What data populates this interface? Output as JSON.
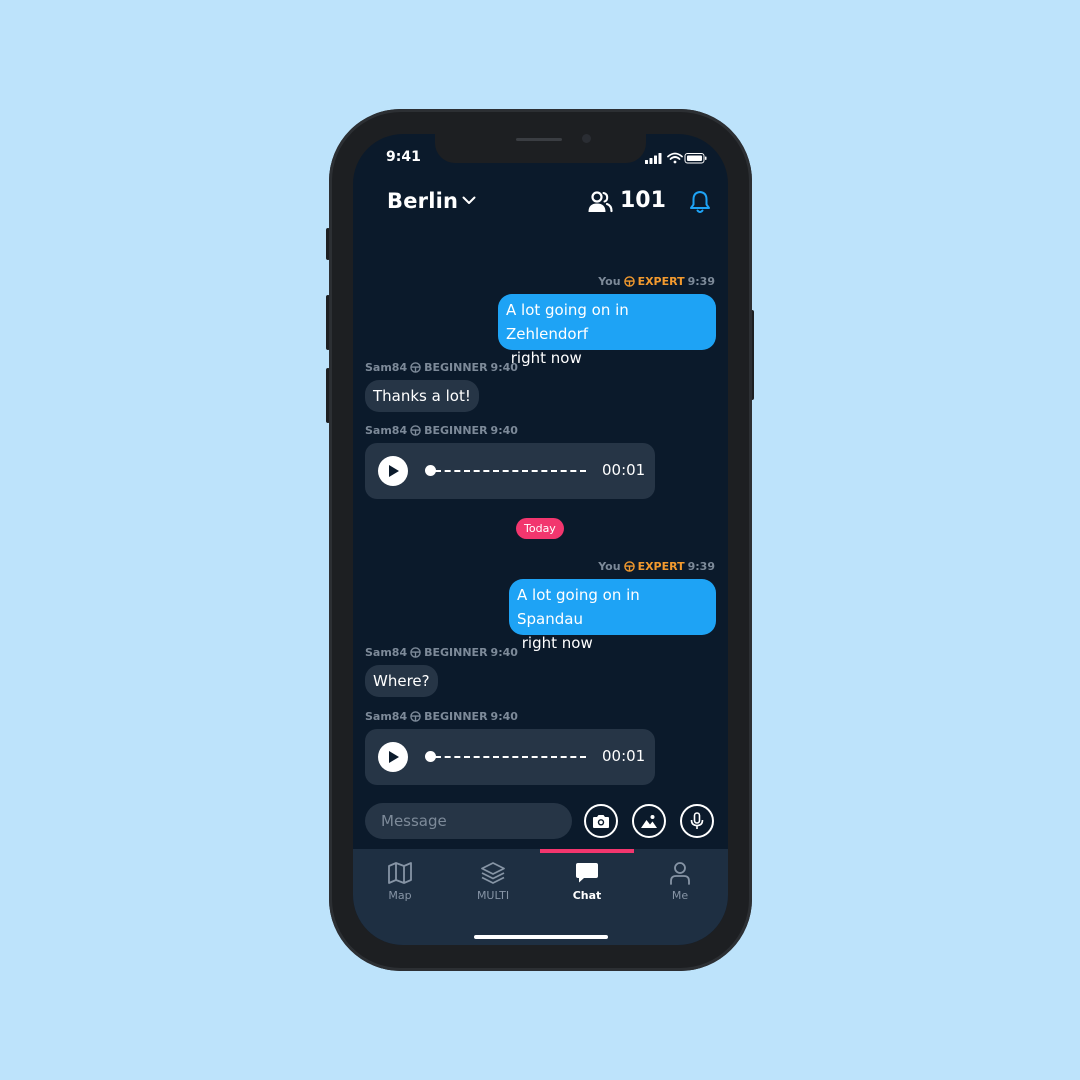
{
  "status": {
    "time": "9:41"
  },
  "header": {
    "city": "Berlin",
    "user_count": "101"
  },
  "messages": [
    {
      "sender": "You",
      "level": "EXPERT",
      "time": "9:39",
      "text_line1": "A lot going on in Zehlendorf",
      "text_line2": " right now"
    },
    {
      "sender": "Sam84",
      "level": "BEGINNER",
      "time": "9:40",
      "text": "Thanks a lot!"
    },
    {
      "sender": "Sam84",
      "level": "BEGINNER",
      "time": "9:40",
      "voice_duration": "00:01"
    },
    {
      "sender": "You",
      "level": "EXPERT",
      "time": "9:39",
      "text_line1": "A lot going on in Spandau",
      "text_line2": " right now"
    },
    {
      "sender": "Sam84",
      "level": "BEGINNER",
      "time": "9:40",
      "text": "Where?"
    },
    {
      "sender": "Sam84",
      "level": "BEGINNER",
      "time": "9:40",
      "voice_duration": "00:01"
    }
  ],
  "divider": {
    "label": "Today"
  },
  "composer": {
    "placeholder": "Message"
  },
  "tabs": [
    {
      "label": "Map",
      "icon": "map-icon"
    },
    {
      "label": "MULTI",
      "icon": "layers-icon"
    },
    {
      "label": "Chat",
      "icon": "chat-icon",
      "active": true
    },
    {
      "label": "Me",
      "icon": "person-icon"
    }
  ],
  "colors": {
    "background": "#bde3fb",
    "screen": "#0b1a2b",
    "outgoing_bubble": "#1ea3f5",
    "incoming_bubble": "#263546",
    "expert": "#f39a2e",
    "accent": "#f2366e",
    "tabbar": "#1e2f42"
  }
}
